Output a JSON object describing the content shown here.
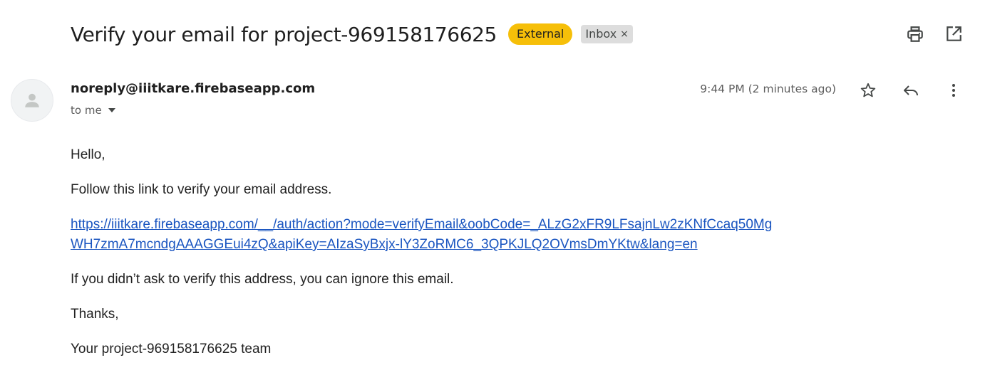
{
  "email": {
    "subject": "Verify your email for project-969158176625",
    "labels": {
      "external": "External",
      "inbox": "Inbox",
      "inbox_remove": "×"
    },
    "sender": "noreply@iiitkare.firebaseapp.com",
    "recipient": "to me",
    "timestamp": "9:44 PM (2 minutes ago)",
    "body": {
      "greeting": "Hello,",
      "intro": "Follow this link to verify your email address.",
      "link_line1": "https://iiitkare.firebaseapp.com/__/auth/action?mode=verifyEmail&oobCode=_ALzG2xFR9LFsajnLw2zKNfCcaq50Mg",
      "link_line2": "WH7zmA7mcndgAAAGGEui4zQ&apiKey=AIzaSyBxjx-lY3ZoRMC6_3QPKJLQ2OVmsDmYKtw&lang=en",
      "ignore_note": "If you didn’t ask to verify this address, you can ignore this email.",
      "thanks": "Thanks,",
      "signature": "Your project-969158176625 team"
    }
  },
  "icons": {
    "print": "printer-icon",
    "open_new_window": "open-in-new-window-icon",
    "avatar": "person-icon",
    "star": "star-icon",
    "reply": "reply-icon",
    "more": "more-vertical-icon",
    "recipient_caret": "caret-down-icon"
  },
  "colors": {
    "external_label": "#f6bf09",
    "inbox_label": "#dddddd",
    "link": "#1a55c0"
  }
}
